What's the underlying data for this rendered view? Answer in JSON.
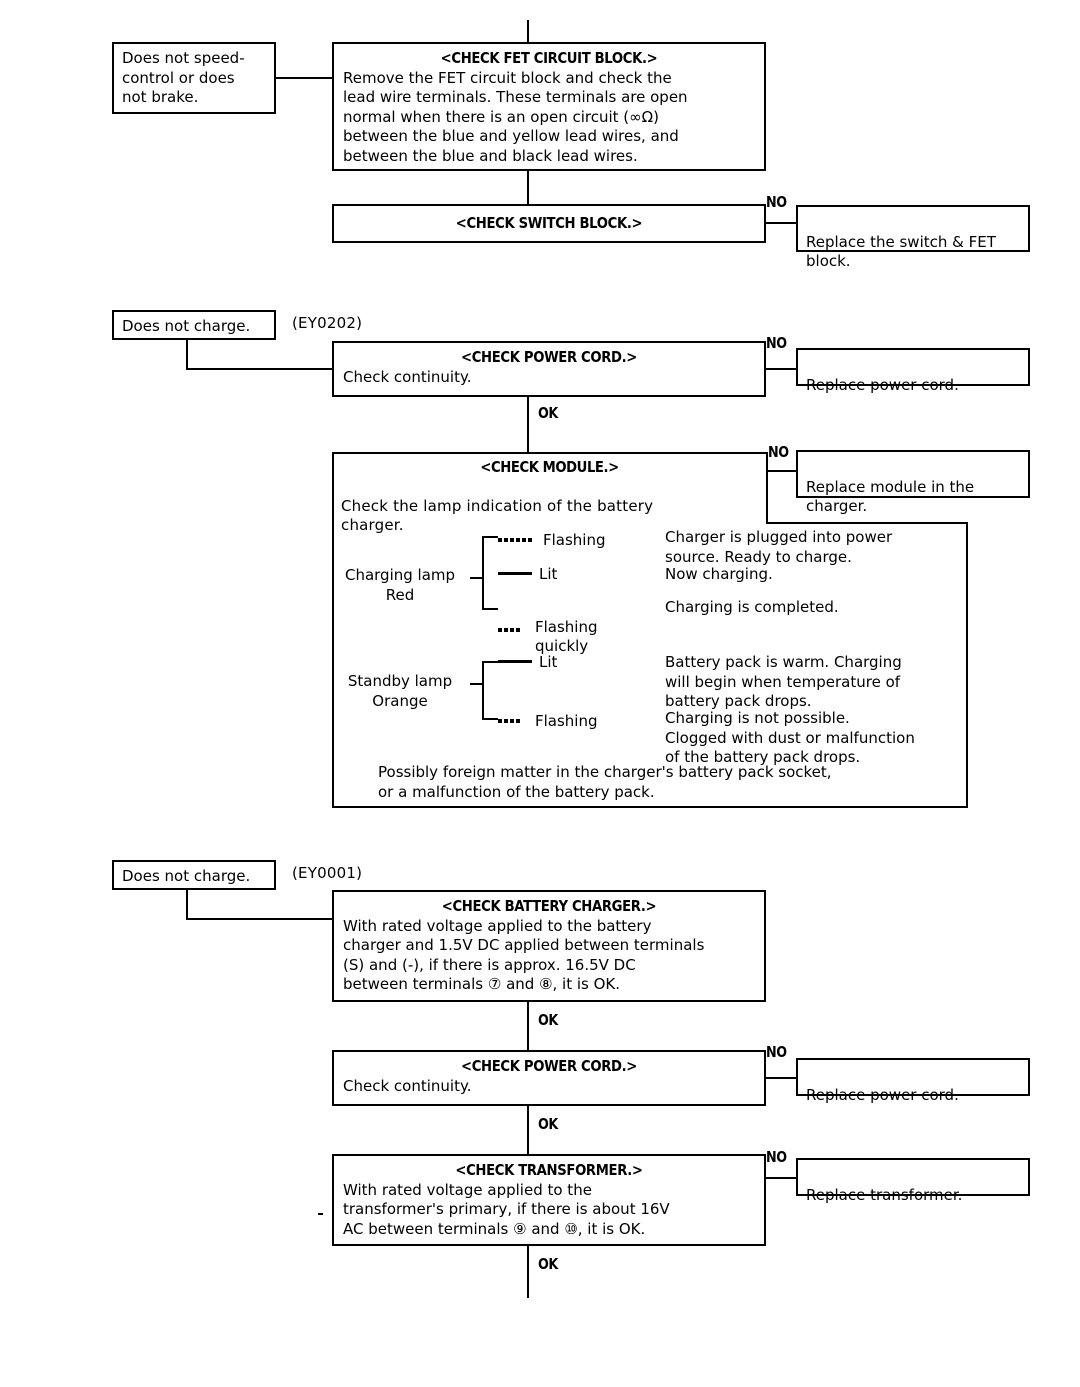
{
  "document": {
    "type": "troubleshooting-flowchart"
  },
  "sections": [
    {
      "id": "speed-control",
      "symptom": "Does not speed-\ncontrol or does\nnot brake.",
      "model": "",
      "steps": [
        {
          "title": "<CHECK FET CIRCUIT BLOCK.>",
          "body": "Remove the FET circuit block and check the\nlead wire terminals. These terminals are open\nnormal when there is an open circuit (∞Ω)\nbetween the blue and yellow lead wires, and\nbetween the blue and black lead wires."
        },
        {
          "title": "<CHECK SWITCH BLOCK.>",
          "body": "",
          "no_label": "NO",
          "no_action": "Replace the switch & FET\nblock."
        }
      ]
    },
    {
      "id": "does-not-charge-ey0202",
      "symptom": "Does not charge.",
      "model": "(EY0202)",
      "steps": [
        {
          "title": "<CHECK POWER CORD.>",
          "body": "Check continuity.",
          "no_label": "NO",
          "no_action": "Replace power cord.",
          "ok_label": "OK"
        },
        {
          "title": "<CHECK MODULE.>",
          "body": "Check the lamp indication of the battery\ncharger.",
          "no_label": "NO",
          "no_action": "Replace module in the\ncharger."
        }
      ]
    },
    {
      "id": "does-not-charge-ey0001",
      "symptom": "Does not charge.",
      "model": "(EY0001)",
      "steps": [
        {
          "title": "<CHECK BATTERY CHARGER.>",
          "body": "With rated voltage applied to the battery\ncharger and 1.5V DC applied between terminals\n(S) and (-), if there is approx. 16.5V DC\nbetween terminals ⑦ and  ⑧, it is OK.",
          "ok_label": "OK"
        },
        {
          "title": "<CHECK POWER CORD.>",
          "body": "Check continuity.",
          "no_label": "NO",
          "no_action": "Replace power cord.",
          "ok_label": "OK"
        },
        {
          "title": "<CHECK TRANSFORMER.>",
          "body": "With rated voltage applied to the\ntransformer's primary, if there is about 16V\nAC between terminals  ⑨ and  ⑩, it is OK.",
          "no_label": "NO",
          "no_action": "Replace transformer.",
          "ok_label": "OK"
        }
      ]
    }
  ],
  "lamp_indication": {
    "rows": [
      {
        "lamp": "Charging lamp\nRed",
        "states": [
          {
            "symbol": "dotted-slow",
            "label": "Flashing",
            "description": "Charger is plugged into power\nsource. Ready to charge."
          },
          {
            "symbol": "solid",
            "label": "Lit",
            "description": "Now charging."
          },
          {
            "symbol": "dotted-fast",
            "label": "Flashing\nquickly",
            "description": "Charging is completed."
          }
        ]
      },
      {
        "lamp": "Standby lamp\nOrange",
        "states": [
          {
            "symbol": "solid",
            "label": "Lit",
            "description": "Battery pack is warm. Charging\nwill begin when temperature of\nbattery pack drops."
          },
          {
            "symbol": "dotted-fast",
            "label": "Flashing",
            "description": "Charging is not possible.\nClogged with dust or malfunction\nof the battery pack drops."
          }
        ]
      }
    ],
    "footnote": "Possibly foreign matter in the charger's battery pack socket,\nor a malfunction of the battery pack."
  }
}
